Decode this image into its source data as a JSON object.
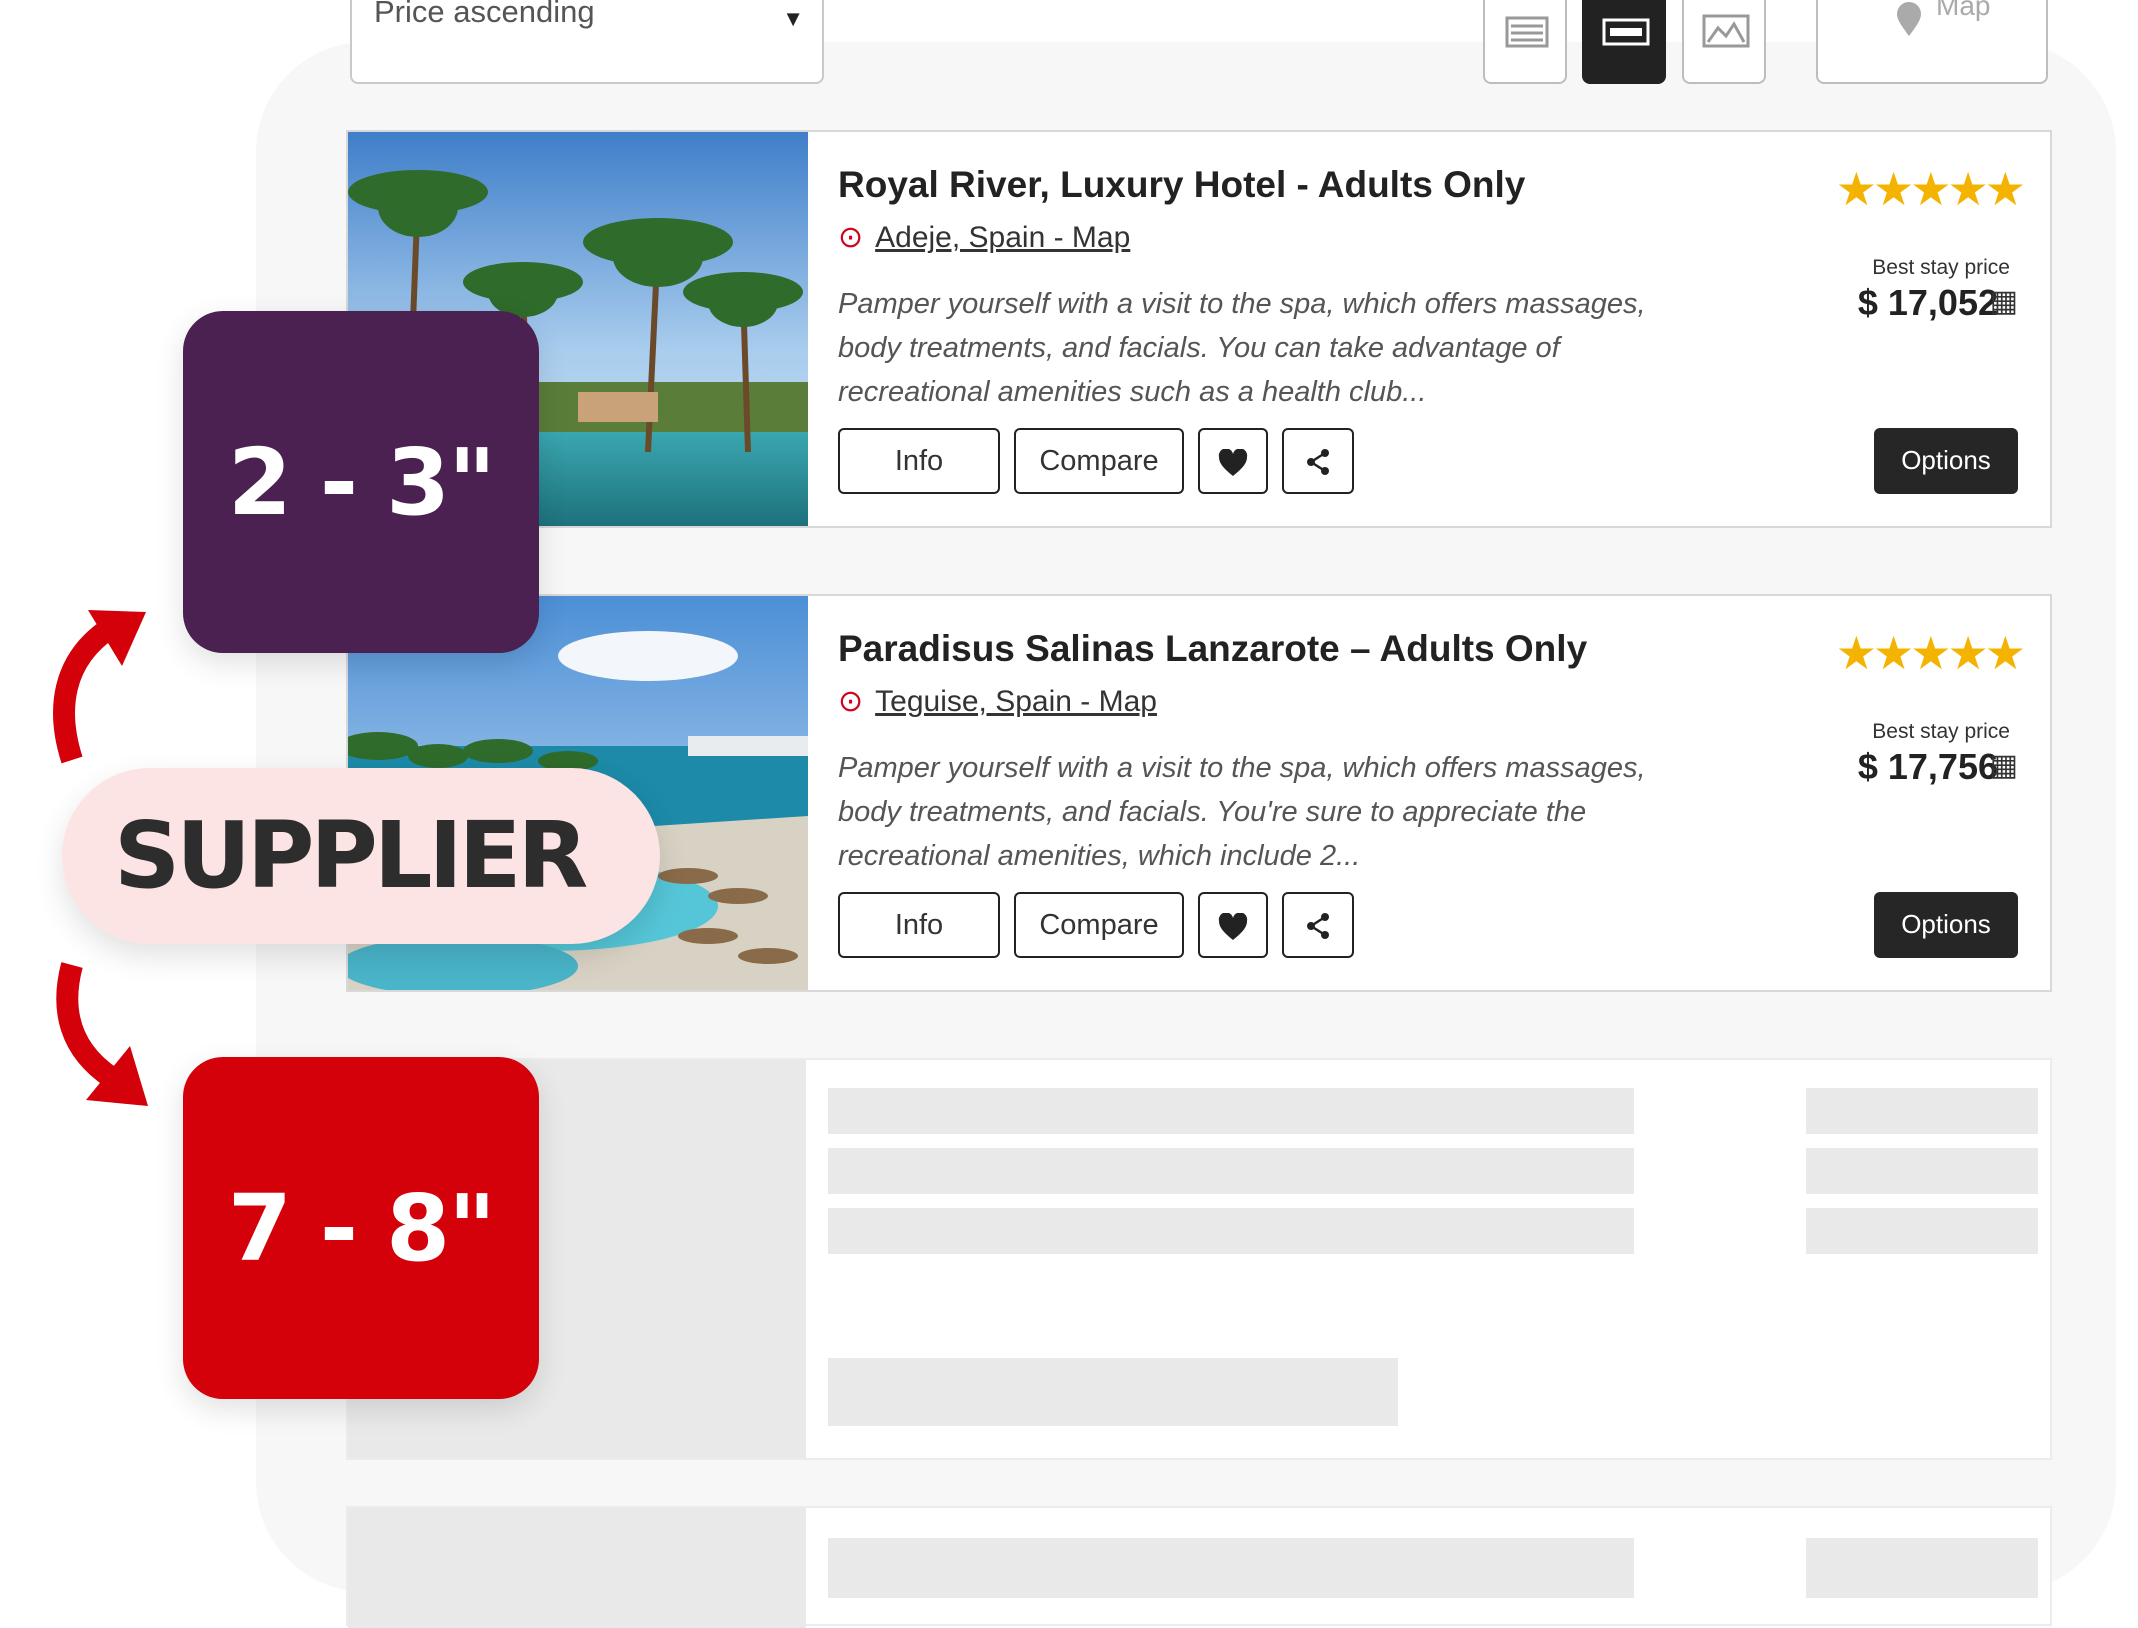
{
  "toolbar": {
    "sort_value": "Price ascending",
    "map_label": "Map"
  },
  "hotels": [
    {
      "name": "Royal River, Luxury Hotel - Adults Only",
      "location": "Adeje, Spain - Map",
      "description": "Pamper yourself with a visit to the spa, which offers massages, body treatments, and facials. You can take advantage of recreational amenities such as a health club...",
      "stars": 5,
      "price_label": "Best stay price",
      "price": "$ 17,052",
      "info_label": "Info",
      "compare_label": "Compare",
      "options_label": "Options"
    },
    {
      "name": "Paradisus Salinas Lanzarote – Adults Only",
      "location": "Teguise, Spain - Map",
      "description": "Pamper yourself with a visit to the spa, which offers massages, body treatments, and facials. You're sure to appreciate the recreational amenities, which include 2...",
      "stars": 5,
      "price_label": "Best stay price",
      "price": "$ 17,756",
      "info_label": "Info",
      "compare_label": "Compare",
      "options_label": "Options"
    }
  ],
  "overlay": {
    "top_badge": "2 - 3\"",
    "supplier": "SUPPLIER",
    "bottom_badge": "7 - 8\""
  },
  "colors": {
    "top_badge": "#4a2150",
    "bottom_badge": "#d4000a",
    "supplier_pill": "#fde4e4",
    "arrow": "#d4000a",
    "stars": "#f5b301"
  },
  "icons": [
    "list-view-icon",
    "card-view-icon",
    "photo-view-icon",
    "map-pin-icon",
    "heart-icon",
    "share-icon",
    "calculator-icon",
    "star-icon"
  ]
}
